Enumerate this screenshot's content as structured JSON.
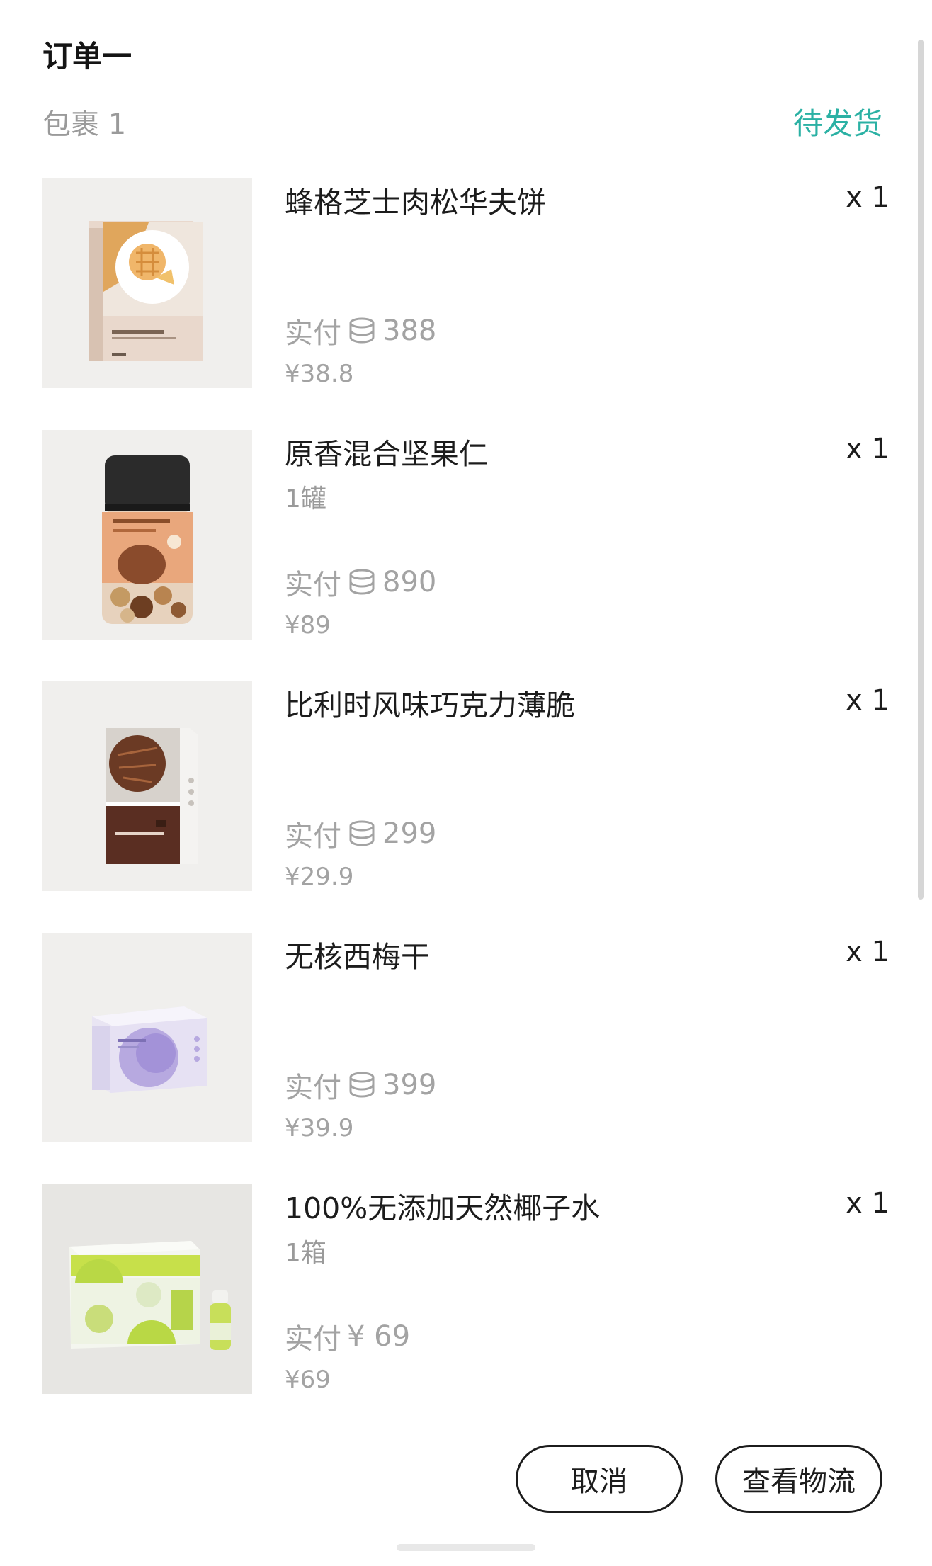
{
  "order": {
    "title": "订单一",
    "package_label": "包裹 1",
    "status": "待发货",
    "status_color": "#2bb1a4"
  },
  "items": [
    {
      "name": "蜂格芝士肉松华夫饼",
      "qty": "x 1",
      "spec": "",
      "paid_label": "实付",
      "paid_value": "388",
      "paid_icon": "coin-stack-icon",
      "price": "¥38.8"
    },
    {
      "name": "原香混合坚果仁",
      "qty": "x 1",
      "spec": "1罐",
      "paid_label": "实付",
      "paid_value": "890",
      "paid_icon": "coin-stack-icon",
      "price": "¥89"
    },
    {
      "name": "比利时风味巧克力薄脆",
      "qty": "x 1",
      "spec": "",
      "paid_label": "实付",
      "paid_value": "299",
      "paid_icon": "coin-stack-icon",
      "price": "¥29.9"
    },
    {
      "name": "无核西梅干",
      "qty": "x 1",
      "spec": "",
      "paid_label": "实付",
      "paid_value": "399",
      "paid_icon": "coin-stack-icon",
      "price": "¥39.9"
    },
    {
      "name": "100%无添加天然椰子水",
      "qty": "x 1",
      "spec": "1箱",
      "paid_label": "实付",
      "paid_value": "¥ 69",
      "paid_icon": "",
      "price": "¥69"
    }
  ],
  "actions": {
    "cancel": "取消",
    "logistics": "查看物流"
  }
}
